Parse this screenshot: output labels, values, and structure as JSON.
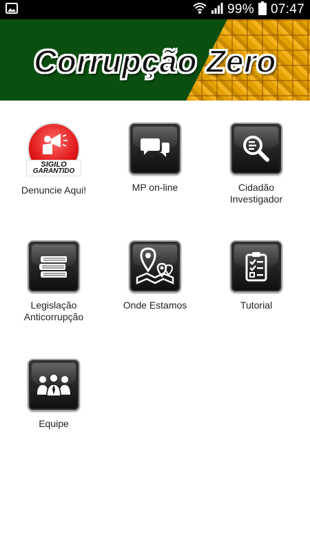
{
  "status_bar": {
    "battery_percent": "99%",
    "time": "07:47",
    "icons": [
      "image-icon",
      "wifi-icon",
      "signal-icon",
      "battery-icon"
    ]
  },
  "banner": {
    "title": "Corrupção Zero",
    "colors": {
      "green": "#0b4f10",
      "gold": "#f3b320"
    }
  },
  "menu": {
    "items": [
      {
        "label": "Denuncie Aqui!",
        "icon": "sigilo-garantido-icon",
        "badge_line1": "SIGILO",
        "badge_line2": "GARANTIDO"
      },
      {
        "label": "MP on-line",
        "icon": "chat-icon"
      },
      {
        "label": "Cidadão\nInvestigador",
        "icon": "search-document-icon"
      },
      {
        "label": "Legislação\nAnticorrupção",
        "icon": "books-icon"
      },
      {
        "label": "Onde Estamos",
        "icon": "map-pins-icon"
      },
      {
        "label": "Tutorial",
        "icon": "checklist-icon"
      },
      {
        "label": "Equipe",
        "icon": "team-icon"
      }
    ]
  }
}
